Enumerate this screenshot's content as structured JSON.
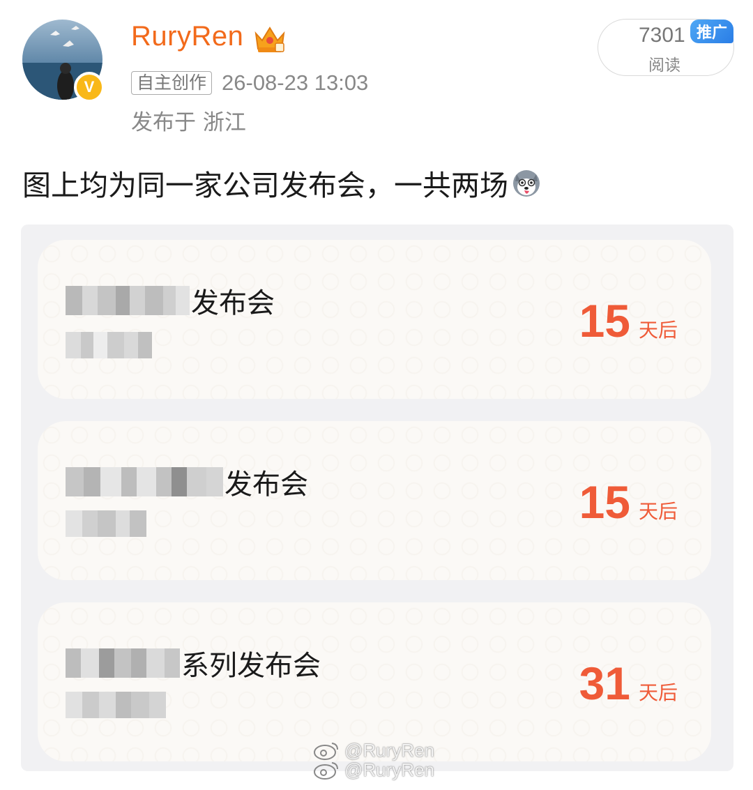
{
  "post": {
    "author": "RuryRen",
    "tag": "自主创作",
    "timestamp": "26-08-23 13:03",
    "location": "发布于 浙江",
    "reads_count": "7301",
    "reads_label": "阅读",
    "promo_label": "推广",
    "text": "图上均为同一家公司发布会，一共两场"
  },
  "cards": [
    {
      "title_suffix": "发布会",
      "countdown": "15",
      "unit": "天后"
    },
    {
      "title_suffix": "发布会",
      "countdown": "15",
      "unit": "天后"
    },
    {
      "title_suffix": "系列发布会",
      "countdown": "31",
      "unit": "天后"
    }
  ],
  "watermark": {
    "line1": "@RuryRen",
    "line2": "@RuryRen"
  },
  "colors": {
    "username": "#f26a1b",
    "countdown": "#ef5b38",
    "verified_badge": "#f9b818",
    "promo_badge": "#2a7de6"
  },
  "icons": [
    "avatar",
    "verified-v-icon",
    "vip-crown-icon",
    "husky-emoji-icon",
    "weibo-logo-icon"
  ]
}
